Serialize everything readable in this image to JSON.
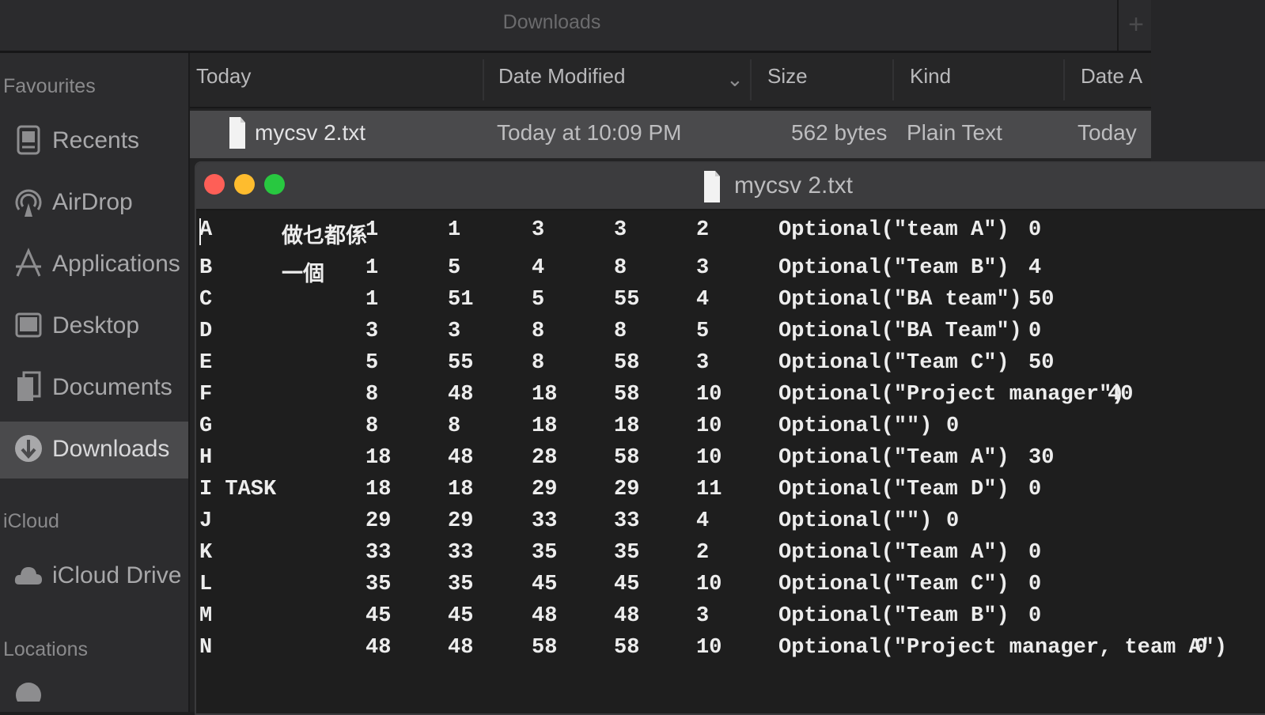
{
  "finder": {
    "title": "Downloads",
    "plus_label": "+",
    "sidebar": {
      "favourites_heading": "Favourites",
      "items": [
        {
          "label": "Recents",
          "icon": "recents-icon"
        },
        {
          "label": "AirDrop",
          "icon": "airdrop-icon"
        },
        {
          "label": "Applications",
          "icon": "applications-icon"
        },
        {
          "label": "Desktop",
          "icon": "desktop-icon"
        },
        {
          "label": "Documents",
          "icon": "documents-icon"
        },
        {
          "label": "Downloads",
          "icon": "downloads-icon",
          "selected": true
        }
      ],
      "icloud_heading": "iCloud",
      "icloud_items": [
        {
          "label": "iCloud Drive",
          "icon": "cloud-icon"
        }
      ],
      "locations_heading": "Locations"
    },
    "columns": {
      "name": "Today",
      "date_modified": "Date Modified",
      "size": "Size",
      "kind": "Kind",
      "date_added": "Date A"
    },
    "file_row": {
      "name": "mycsv 2.txt",
      "date_modified": "Today at 10:09 PM",
      "size": "562 bytes",
      "kind": "Plain Text",
      "date_added": "Today"
    }
  },
  "editor": {
    "title": "mycsv 2.txt",
    "rows": [
      [
        "A",
        "做乜都係",
        "1",
        "1",
        "3",
        "3",
        "2",
        "Optional(\"team A\")",
        "0"
      ],
      [
        "B",
        "一個",
        "1",
        "5",
        "4",
        "8",
        "3",
        "Optional(\"Team B\")",
        "4"
      ],
      [
        "C",
        "",
        "1",
        "51",
        "5",
        "55",
        "4",
        "Optional(\"BA team\")",
        "50"
      ],
      [
        "D",
        "",
        "3",
        "3",
        "8",
        "8",
        "5",
        "Optional(\"BA Team\")",
        "0"
      ],
      [
        "E",
        "",
        "5",
        "55",
        "8",
        "58",
        "3",
        "Optional(\"Team C\")",
        "50"
      ],
      [
        "F",
        "",
        "8",
        "48",
        "18",
        "58",
        "10",
        "Optional(\"Project manager\")",
        "40"
      ],
      [
        "G",
        "",
        "8",
        "8",
        "18",
        "18",
        "10",
        "Optional(\"\")",
        "0"
      ],
      [
        "H",
        "",
        "18",
        "48",
        "28",
        "58",
        "10",
        "Optional(\"Team A\")",
        "30"
      ],
      [
        "I TASK",
        "",
        "18",
        "18",
        "29",
        "29",
        "11",
        "Optional(\"Team D\")",
        "0"
      ],
      [
        "J",
        "",
        "29",
        "29",
        "33",
        "33",
        "4",
        "Optional(\"\")",
        "0"
      ],
      [
        "K",
        "",
        "33",
        "33",
        "35",
        "35",
        "2",
        "Optional(\"Team A\")",
        "0"
      ],
      [
        "L",
        "",
        "35",
        "35",
        "45",
        "45",
        "10",
        "Optional(\"Team C\")",
        "0"
      ],
      [
        "M",
        "",
        "45",
        "45",
        "48",
        "48",
        "3",
        "Optional(\"Team B\")",
        "0"
      ],
      [
        "N",
        "",
        "48",
        "48",
        "58",
        "58",
        "10",
        "Optional(\"Project manager, team A\")",
        "0"
      ]
    ]
  },
  "colors": {
    "close": "#fe5f57",
    "minimize": "#febc2e",
    "zoom": "#28c840"
  }
}
